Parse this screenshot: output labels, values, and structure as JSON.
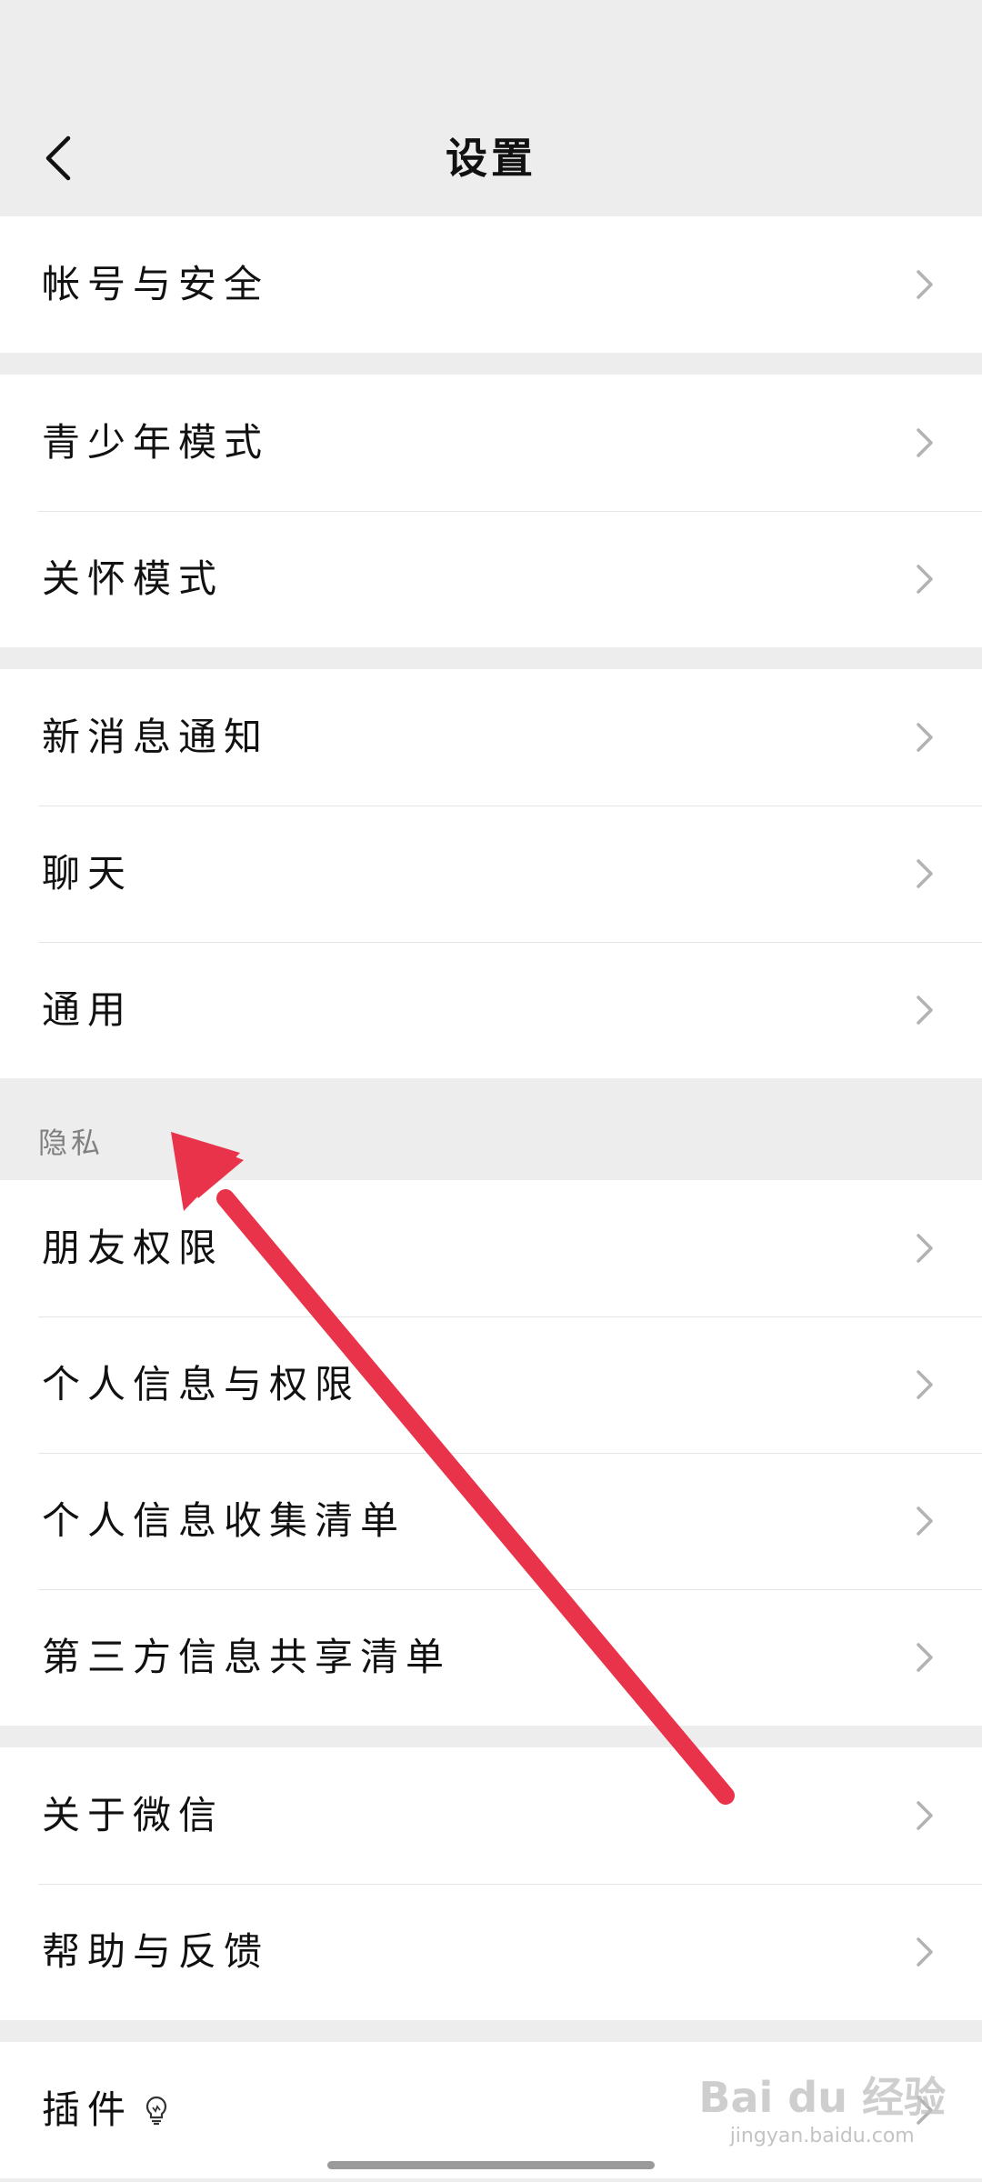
{
  "header": {
    "title": "设置"
  },
  "groups": [
    {
      "items": [
        {
          "label": "帐号与安全"
        }
      ]
    },
    {
      "items": [
        {
          "label": "青少年模式"
        },
        {
          "label": "关怀模式"
        }
      ]
    },
    {
      "items": [
        {
          "label": "新消息通知"
        },
        {
          "label": "聊天"
        },
        {
          "label": "通用"
        }
      ]
    },
    {
      "section_title": "隐私",
      "items": [
        {
          "label": "朋友权限"
        },
        {
          "label": "个人信息与权限"
        },
        {
          "label": "个人信息收集清单"
        },
        {
          "label": "第三方信息共享清单"
        }
      ]
    },
    {
      "items": [
        {
          "label": "关于微信"
        },
        {
          "label": "帮助与反馈"
        }
      ]
    },
    {
      "items": [
        {
          "label": "插件",
          "icon": "lightbulb-icon"
        }
      ]
    }
  ],
  "icons": {
    "back": "chevron-left-icon",
    "row_arrow": "chevron-right-icon"
  },
  "colors": {
    "background": "#ededed",
    "row_bg": "#ffffff",
    "annotation_arrow": "#e8334a"
  },
  "watermark": {
    "brand": "Bai du 经验",
    "url": "jingyan.baidu.com"
  }
}
